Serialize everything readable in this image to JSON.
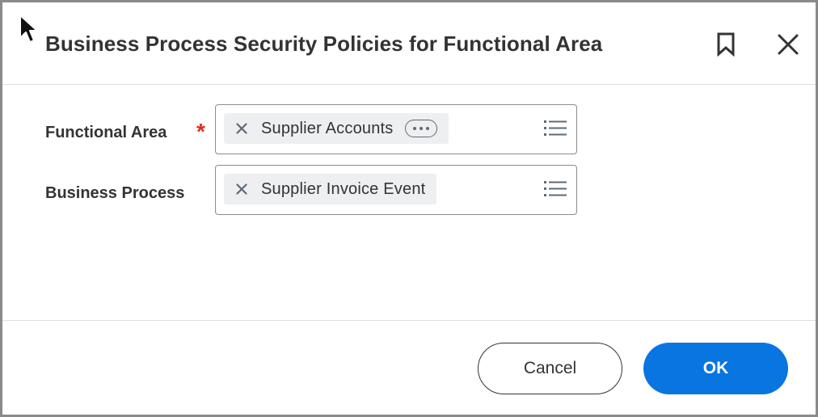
{
  "dialog": {
    "title": "Business Process Security Policies for Functional Area"
  },
  "form": {
    "functional_area": {
      "label": "Functional Area",
      "required_mark": "*",
      "selected": "Supplier Accounts"
    },
    "business_process": {
      "label": "Business Process",
      "selected": "Supplier Invoice Event"
    }
  },
  "footer": {
    "cancel_label": "Cancel",
    "ok_label": "OK"
  },
  "colors": {
    "primary": "#0875e1",
    "required": "#de2e21",
    "text": "#333333"
  },
  "icons": {
    "cursor": "mouse-pointer-icon",
    "bookmark": "bookmark-icon",
    "close": "close-icon",
    "remove": "remove-x-icon",
    "more": "more-options-icon",
    "list": "list-prompt-icon"
  }
}
